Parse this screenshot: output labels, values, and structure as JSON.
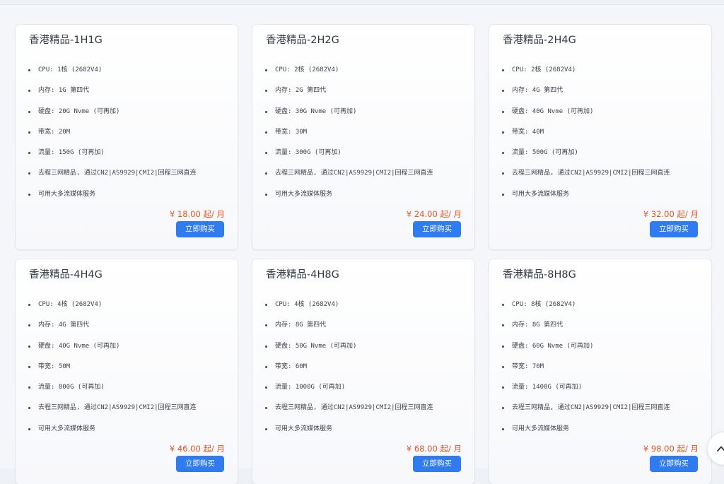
{
  "plans": [
    {
      "title": "香港精品-1H1G",
      "specs": [
        "CPU: 1核 (2682V4)",
        "内存: 1G 第四代",
        "硬盘: 20G Nvme (可再加)",
        "带宽: 20M",
        "流量: 150G (可再加)",
        "去程三网精品, 通过CN2|AS9929|CMI2|回程三网直连",
        "可用大多流媒体服务"
      ],
      "price": "¥ 18.00 起/ 月",
      "buy_label": "立即购买"
    },
    {
      "title": "香港精品-2H2G",
      "specs": [
        "CPU: 2核 (2682V4)",
        "内存: 2G 第四代",
        "硬盘: 30G Nvme (可再加)",
        "带宽: 30M",
        "流量: 300G (可再加)",
        "去程三网精品, 通过CN2|AS9929|CMI2|回程三网直连",
        "可用大多流媒体服务"
      ],
      "price": "¥ 24.00 起/ 月",
      "buy_label": "立即购买"
    },
    {
      "title": "香港精品-2H4G",
      "specs": [
        "CPU: 2核 (2682V4)",
        "内存: 4G 第四代",
        "硬盘: 40G Nvme (可再加)",
        "带宽: 40M",
        "流量: 500G (可再加)",
        "去程三网精品, 通过CN2|AS9929|CMI2|回程三网直连",
        "可用大多流媒体服务"
      ],
      "price": "¥ 32.00 起/ 月",
      "buy_label": "立即购买"
    },
    {
      "title": "香港精品-4H4G",
      "specs": [
        "CPU: 4核 (2682V4)",
        "内存: 4G 第四代",
        "硬盘: 40G Nvme (可再加)",
        "带宽: 50M",
        "流量: 800G (可再加)",
        "去程三网精品, 通过CN2|AS9929|CMI2|回程三网直连",
        "可用大多流媒体服务"
      ],
      "price": "¥ 46.00 起/ 月",
      "buy_label": "立即购买"
    },
    {
      "title": "香港精品-4H8G",
      "specs": [
        "CPU: 4核 (2682V4)",
        "内存: 8G 第四代",
        "硬盘: 50G Nvme (可再加)",
        "带宽: 60M",
        "流量: 1000G (可再加)",
        "去程三网精品, 通过CN2|AS9929|CMI2|回程三网直连",
        "可用大多流媒体服务"
      ],
      "price": "¥ 68.00 起/ 月",
      "buy_label": "立即购买"
    },
    {
      "title": "香港精品-8H8G",
      "specs": [
        "CPU: 8核 (2682V4)",
        "内存: 8G 第四代",
        "硬盘: 60G Nvme (可再加)",
        "带宽: 70M",
        "流量: 1400G (可再加)",
        "去程三网精品, 通过CN2|AS9929|CMI2|回程三网直连",
        "可用大多流媒体服务"
      ],
      "price": "¥ 98.00 起/ 月",
      "buy_label": "立即购买"
    }
  ],
  "back_to_top": {
    "icon": "chevron-up-icon"
  },
  "colors": {
    "accent": "#2f7bef",
    "price": "#e8531e",
    "background": "#eef1f6"
  }
}
